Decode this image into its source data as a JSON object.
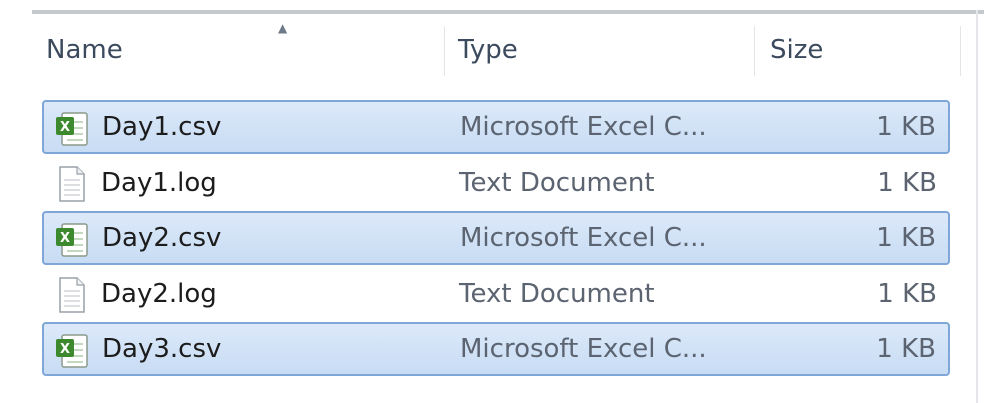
{
  "columns": {
    "name": "Name",
    "type": "Type",
    "size": "Size"
  },
  "sort": {
    "column": "name",
    "indicator": "▲"
  },
  "files": [
    {
      "name": "Day1.csv",
      "type": "Microsoft Excel C...",
      "size": "1 KB",
      "icon": "excel-csv-icon",
      "selected": true
    },
    {
      "name": "Day1.log",
      "type": "Text Document",
      "size": "1 KB",
      "icon": "text-document-icon",
      "selected": false
    },
    {
      "name": "Day2.csv",
      "type": "Microsoft Excel C...",
      "size": "1 KB",
      "icon": "excel-csv-icon",
      "selected": true
    },
    {
      "name": "Day2.log",
      "type": "Text Document",
      "size": "1 KB",
      "icon": "text-document-icon",
      "selected": false
    },
    {
      "name": "Day3.csv",
      "type": "Microsoft Excel C...",
      "size": "1 KB",
      "icon": "excel-csv-icon",
      "selected": true
    }
  ],
  "colors": {
    "selection_fill": "#d3e3f7",
    "selection_border": "#7ea6d6",
    "header_text": "#3c4a5e",
    "excel_green": "#3d8a2e"
  }
}
